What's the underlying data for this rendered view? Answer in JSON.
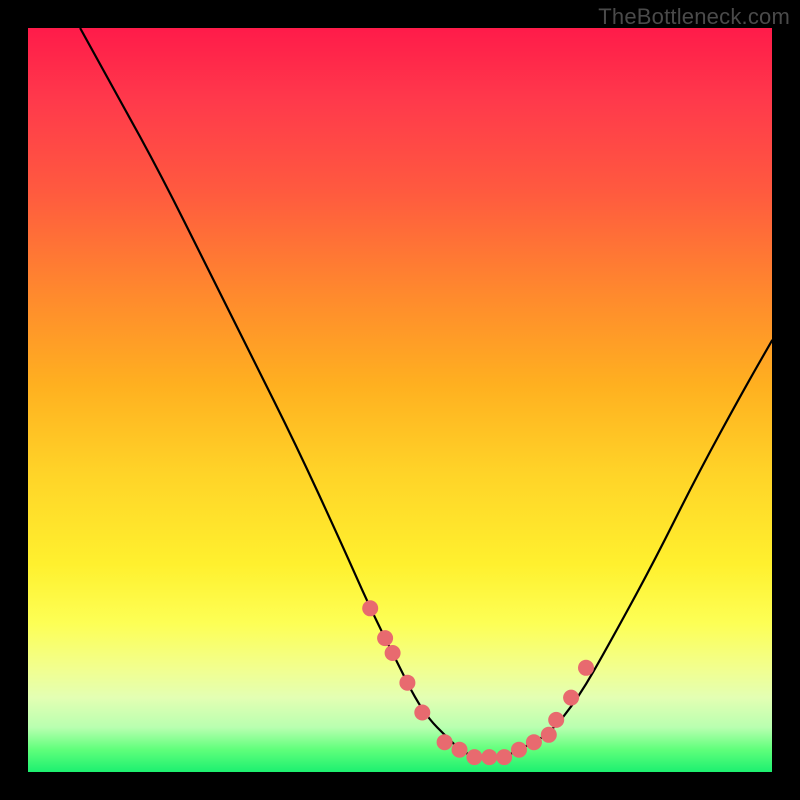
{
  "watermark": "TheBottleneck.com",
  "colors": {
    "marker": "#e86a6f",
    "curve": "#000000",
    "frame": "#000000"
  },
  "chart_data": {
    "type": "line",
    "title": "",
    "xlabel": "",
    "ylabel": "",
    "xlim": [
      0,
      100
    ],
    "ylim": [
      0,
      100
    ],
    "grid": false,
    "legend": false,
    "series": [
      {
        "name": "bottleneck-curve",
        "x": [
          7,
          12,
          18,
          24,
          30,
          36,
          42,
          46,
          50,
          52,
          54,
          56,
          58,
          60,
          62,
          64,
          66,
          70,
          74,
          78,
          84,
          90,
          96,
          100
        ],
        "values": [
          100,
          91,
          80,
          68,
          56,
          44,
          31,
          22,
          14,
          10,
          7,
          5,
          3,
          2,
          2,
          2,
          3,
          5,
          10,
          17,
          28,
          40,
          51,
          58
        ]
      }
    ],
    "markers": {
      "name": "highlight-points",
      "x": [
        46,
        48,
        49,
        51,
        53,
        56,
        58,
        60,
        62,
        64,
        66,
        68,
        70,
        71,
        73,
        75
      ],
      "values": [
        22,
        18,
        16,
        12,
        8,
        4,
        3,
        2,
        2,
        2,
        3,
        4,
        5,
        7,
        10,
        14
      ]
    }
  }
}
